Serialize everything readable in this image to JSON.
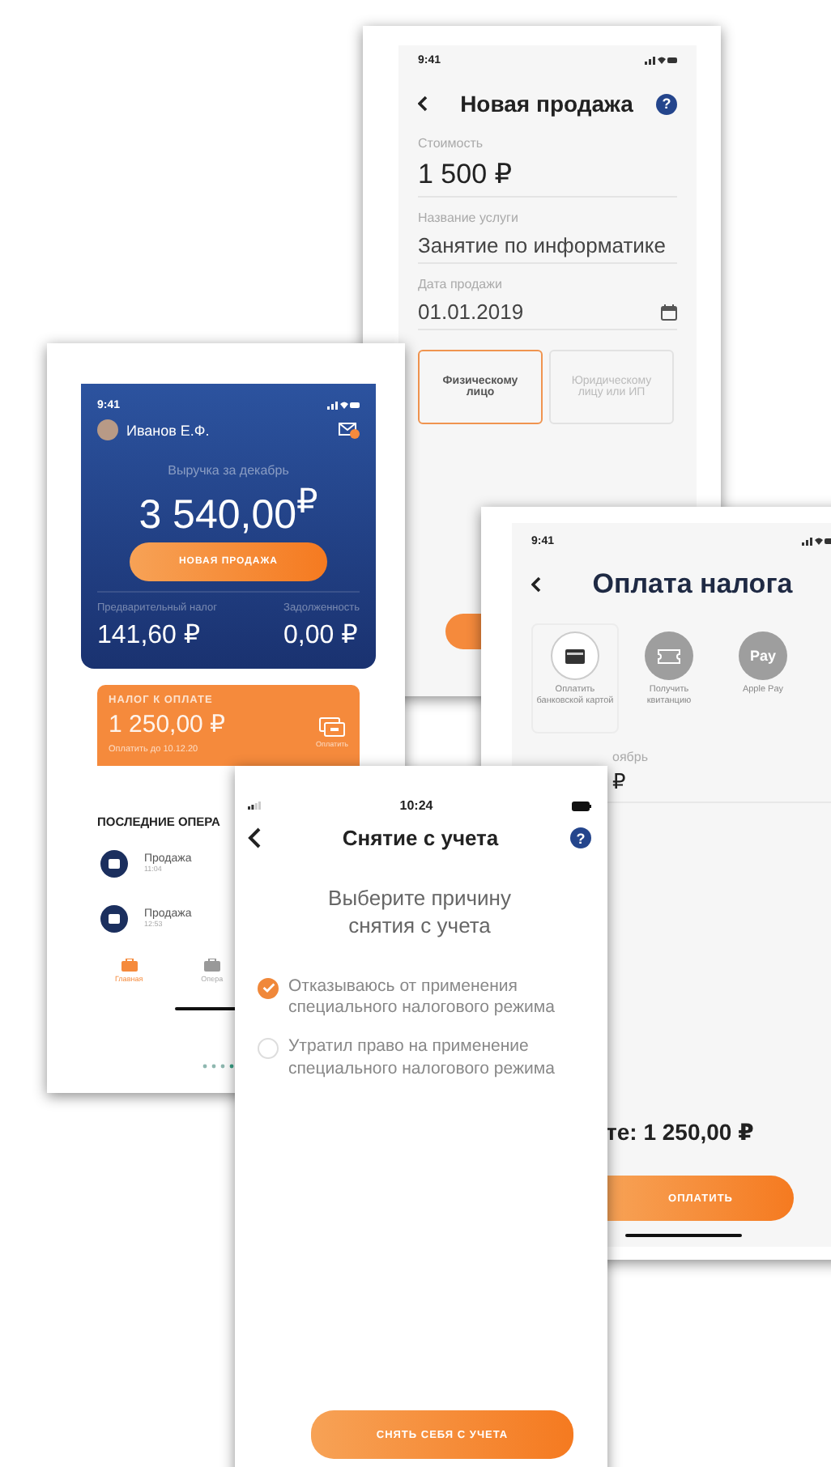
{
  "new_sale_screen": {
    "status_time": "9:41",
    "title": "Новая продажа",
    "help_label": "?",
    "fields": [
      {
        "label": "Стоимость",
        "value": "1 500 ₽",
        "kind": "amount"
      },
      {
        "label": "Название услуги",
        "value": "Занятие по информатике",
        "kind": "text"
      },
      {
        "label": "Дата продажи",
        "value": "01.01.2019",
        "kind": "date"
      }
    ],
    "buyer_options": [
      {
        "label": "Физическому лицо",
        "selected": true
      },
      {
        "label": "Юридическому лицу или ИП",
        "selected": false
      }
    ]
  },
  "home_screen": {
    "status_time": "9:41",
    "user_name": "Иванов Е.Ф.",
    "revenue_label": "Выручка за декабрь",
    "revenue": "3 540,00$^{₽}$",
    "new_sale_button": "НОВАЯ ПРОДАЖА",
    "stats": [
      {
        "label": "Предварительный налог",
        "value": "141,60 ₽"
      },
      {
        "label": "Задолженность",
        "value": "0,00 ₽"
      }
    ],
    "tax_card": {
      "title": "НАЛОГ К ОПЛАТЕ",
      "amount": "1 250,00 ₽",
      "due": "Оплатить до 10.12.20",
      "action": "Оплатить"
    },
    "recent_title": "ПОСЛЕДНИЕ ОПЕРА",
    "operations": [
      {
        "name": "Продажа",
        "time": "11:04"
      },
      {
        "name": "Продажа",
        "time": "12:53"
      }
    ],
    "tabs": [
      {
        "label": "Главная",
        "selected": true
      },
      {
        "label": "Опера",
        "selected": false
      }
    ]
  },
  "tax_payment_screen": {
    "status_time": "9:41",
    "title": "Оплата налога",
    "methods": [
      {
        "label": "Оплатить банковской картой",
        "selected": true,
        "kind": "card"
      },
      {
        "label": "Получить квитанцию",
        "selected": false,
        "kind": "receipt"
      },
      {
        "label": "Apple Pay",
        "selected": false,
        "kind": "wallet",
        "icon_text": "Pay"
      }
    ],
    "period_label": "оябрь",
    "period_value": "₽",
    "total": "те: 1 250,00 ₽",
    "pay_button": "ОПЛАТИТЬ"
  },
  "deregistration_screen": {
    "status_time": "10:24",
    "title": "Снятие с учета",
    "help_label": "?",
    "prompt": "Выберите причину снятия с учета",
    "reasons": [
      {
        "label": "Отказываюсь от применения специального налогового режима",
        "selected": true
      },
      {
        "label": "Утратил право на применение специального налогового режима",
        "selected": false
      }
    ],
    "button": "СНЯТЬ СЕБЯ С УЧЕТА"
  }
}
